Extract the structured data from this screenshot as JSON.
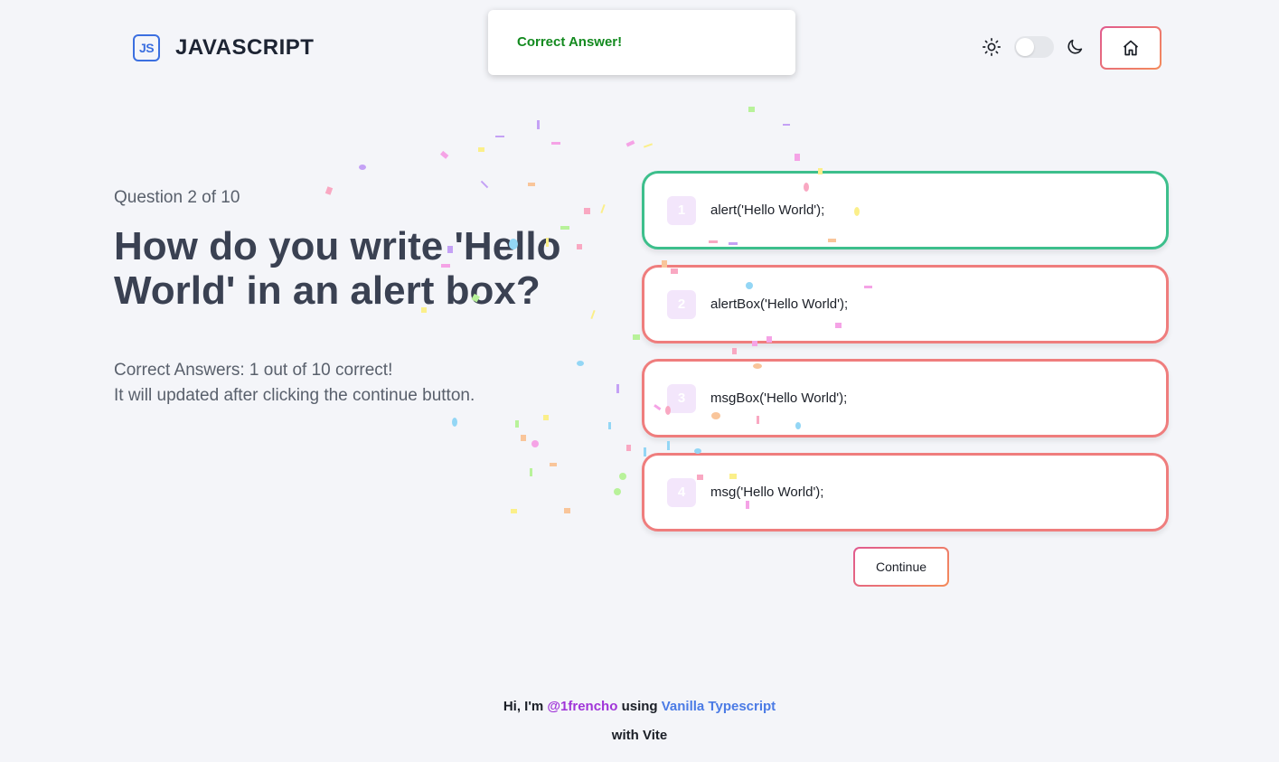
{
  "header": {
    "logo_badge": "JS",
    "title": "JAVASCRIPT"
  },
  "toast": {
    "message": "Correct Answer!"
  },
  "theme": {
    "mode": "light"
  },
  "question": {
    "counter": "Question 2 of 10",
    "text": "How do you write 'Hello World' in an alert box?"
  },
  "score": {
    "line1": "Correct Answers: 1 out of 10 correct!",
    "line2": "It will updated after clicking the continue button."
  },
  "options": [
    {
      "number": "1",
      "text": "alert('Hello World');",
      "status": "correct"
    },
    {
      "number": "2",
      "text": "alertBox('Hello World');",
      "status": "wrong"
    },
    {
      "number": "3",
      "text": "msgBox('Hello World');",
      "status": "wrong"
    },
    {
      "number": "4",
      "text": "msg('Hello World');",
      "status": "wrong"
    }
  ],
  "continue_label": "Continue",
  "footer": {
    "prefix": "Hi, I'm",
    "author": "@1frencho",
    "middle": "using",
    "tech": "Vanilla Typescript",
    "line2": "with Vite"
  },
  "colors": {
    "correct": "#3dbf8c",
    "wrong": "#ef7d7d",
    "toast_text": "#138a1f",
    "accent": "#e4607c"
  }
}
